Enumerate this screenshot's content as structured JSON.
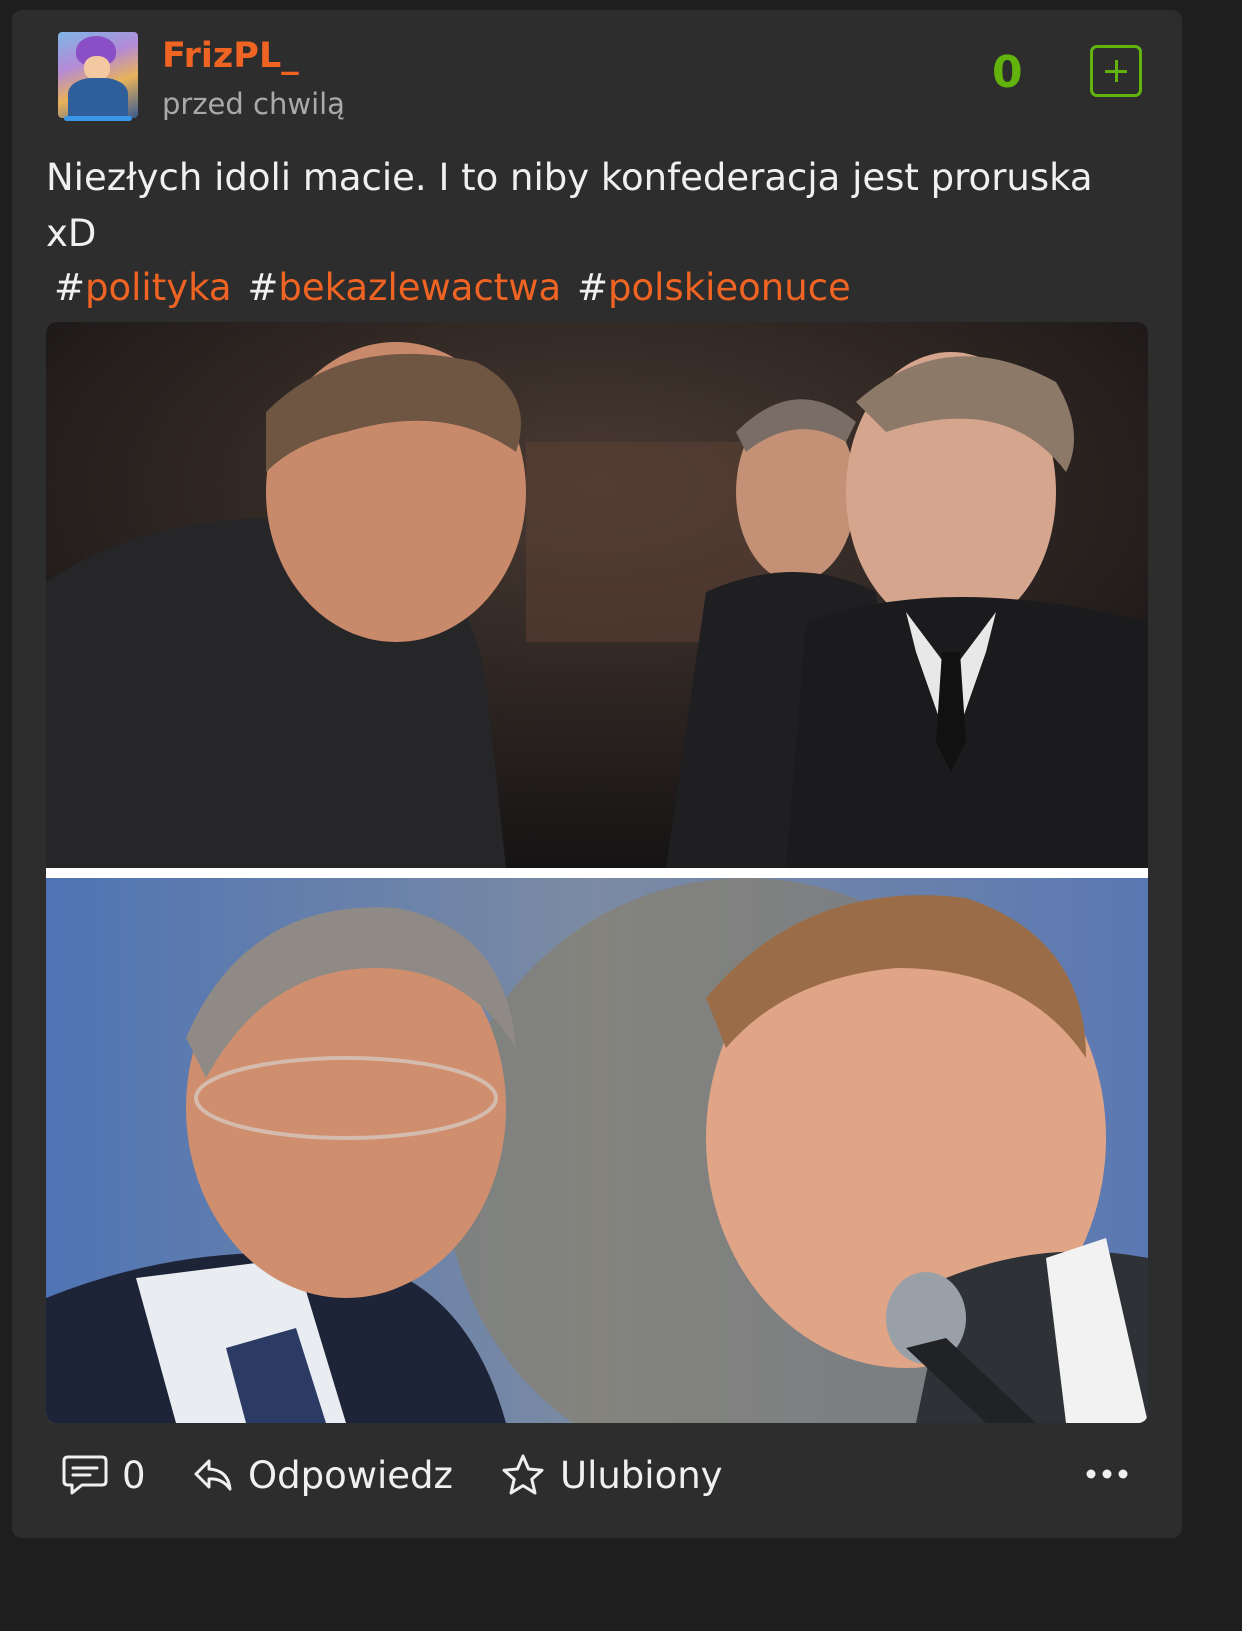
{
  "post": {
    "author": "FrizPL_",
    "time": "przed chwilą",
    "score": "0",
    "text": "Niezłych idoli macie. I to niby konfederacja jest proruska xD",
    "tags": [
      "polityka",
      "bekazlewactwa",
      "polskieonuce"
    ]
  },
  "footer": {
    "comments_count": "0",
    "reply_label": "Odpowiedz",
    "favorite_label": "Ulubiony"
  },
  "icons": {
    "upvote": "plus-square-icon",
    "comments": "comment-bubble-icon",
    "reply": "reply-arrow-icon",
    "favorite": "star-outline-icon",
    "more": "ellipsis-icon"
  },
  "colors": {
    "accent": "#f06423",
    "score": "#62b40c",
    "card_background": "#2d2d2d",
    "page_background": "#1e1e1e",
    "muted_text": "#a9a9a9"
  }
}
